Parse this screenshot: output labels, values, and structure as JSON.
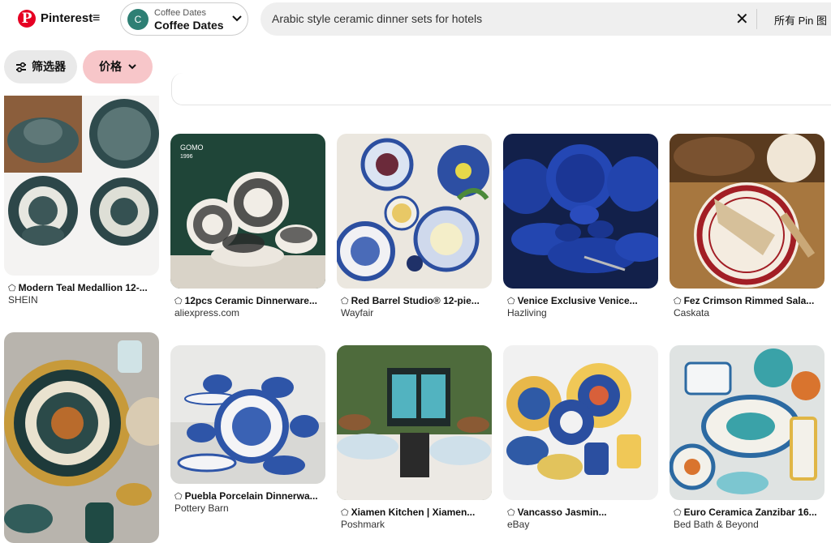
{
  "header": {
    "logo_letter": "P",
    "brand": "Pinterest",
    "menu_icon": "≡",
    "board": {
      "avatar_letter": "C",
      "small_label": "Coffee Dates",
      "name": "Coffee Dates",
      "chevron": "⌄"
    },
    "search": {
      "query": "Arabic style ceramic dinner sets for hotels",
      "clear_icon": "✕",
      "scope": "所有 Pin 图"
    }
  },
  "filters": [
    {
      "icon": "⚙",
      "label": "筛选器"
    },
    {
      "label": "价格",
      "chevron": "⌄"
    }
  ],
  "pins": [
    {
      "title": "Modern Teal Medallion 12-...",
      "source": "SHEIN"
    },
    {
      "title": "12pcs Ceramic Dinnerware...",
      "source": "aliexpress.com"
    },
    {
      "title": "Red Barrel Studio® 12-pie...",
      "source": "Wayfair"
    },
    {
      "title": "Venice Exclusive Venice...",
      "source": "Hazliving"
    },
    {
      "title": "Fez Crimson Rimmed Sala...",
      "source": "Caskata"
    },
    {
      "title": "",
      "source": ""
    },
    {
      "title": "Puebla Porcelain Dinnerwa...",
      "source": "Pottery Barn"
    },
    {
      "title": "Xiamen Kitchen | Xiamen...",
      "source": "Poshmark"
    },
    {
      "title": "Vancasso Jasmin...",
      "source": "eBay"
    },
    {
      "title": "Euro Ceramica Zanzibar 16...",
      "source": "Bed Bath & Beyond"
    }
  ],
  "image_text": {
    "logo_line1": "GOMO",
    "logo_line2": "1996"
  },
  "colors": {
    "brand_red": "#e60023",
    "price_chip": "#f7c6c9",
    "filter_chip": "#e9e9e9"
  }
}
